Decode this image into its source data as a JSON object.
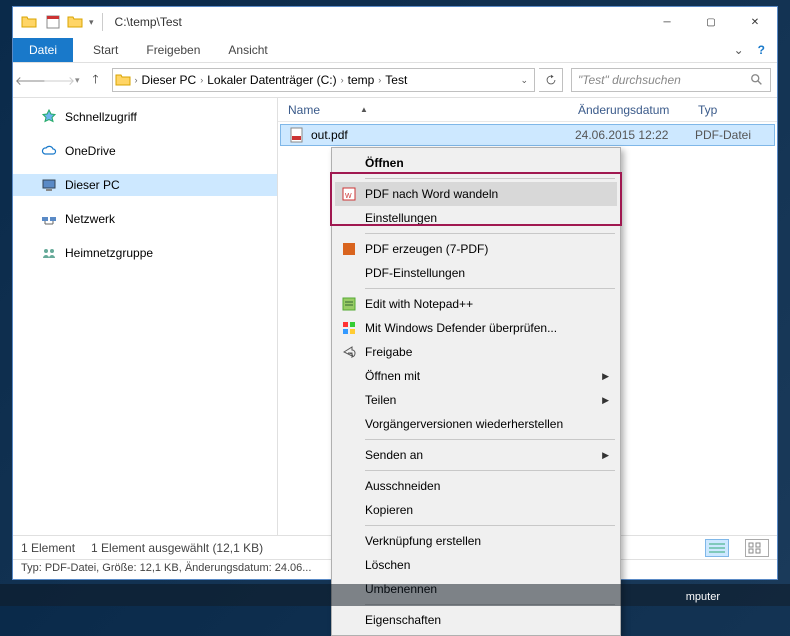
{
  "title": "C:\\temp\\Test",
  "ribbon": {
    "file": "Datei",
    "tabs": [
      "Start",
      "Freigeben",
      "Ansicht"
    ]
  },
  "breadcrumb": [
    "Dieser PC",
    "Lokaler Datenträger (C:)",
    "temp",
    "Test"
  ],
  "search_placeholder": "\"Test\" durchsuchen",
  "nav": [
    {
      "label": "Schnellzugriff",
      "icon": "star"
    },
    {
      "gap": true
    },
    {
      "label": "OneDrive",
      "icon": "cloud"
    },
    {
      "gap": true
    },
    {
      "label": "Dieser PC",
      "icon": "pc",
      "selected": true
    },
    {
      "gap": true
    },
    {
      "label": "Netzwerk",
      "icon": "network"
    },
    {
      "gap": true
    },
    {
      "label": "Heimnetzgruppe",
      "icon": "homegroup"
    }
  ],
  "columns": {
    "name": "Name",
    "date": "Änderungsdatum",
    "type": "Typ"
  },
  "file": {
    "name": "out.pdf",
    "date": "24.06.2015 12:22",
    "type": "PDF-Datei"
  },
  "context_menu": [
    {
      "label": "Öffnen",
      "bold": true
    },
    {
      "sep": true
    },
    {
      "label": "PDF nach Word wandeln",
      "icon": "pdfword",
      "hover": true
    },
    {
      "label": "Einstellungen"
    },
    {
      "sep": true
    },
    {
      "label": "PDF erzeugen (7-PDF)",
      "icon": "pdf7"
    },
    {
      "label": "PDF-Einstellungen"
    },
    {
      "sep": true
    },
    {
      "label": "Edit with Notepad++",
      "icon": "npp"
    },
    {
      "label": "Mit Windows Defender überprüfen...",
      "icon": "defender"
    },
    {
      "label": "Freigabe",
      "icon": "share"
    },
    {
      "label": "Öffnen mit",
      "arrow": true
    },
    {
      "label": "Teilen",
      "arrow": true
    },
    {
      "label": "Vorgängerversionen wiederherstellen"
    },
    {
      "sep": true
    },
    {
      "label": "Senden an",
      "arrow": true
    },
    {
      "sep": true
    },
    {
      "label": "Ausschneiden"
    },
    {
      "label": "Kopieren"
    },
    {
      "sep": true
    },
    {
      "label": "Verknüpfung erstellen"
    },
    {
      "label": "Löschen"
    },
    {
      "label": "Umbenennen"
    },
    {
      "sep": true
    },
    {
      "label": "Eigenschaften"
    }
  ],
  "status": {
    "count": "1 Element",
    "selected": "1 Element ausgewählt (12,1 KB)"
  },
  "info_line": "Typ: PDF-Datei, Größe: 12,1 KB, Änderungsdatum: 24.06...",
  "taskbar_right": "mputer"
}
